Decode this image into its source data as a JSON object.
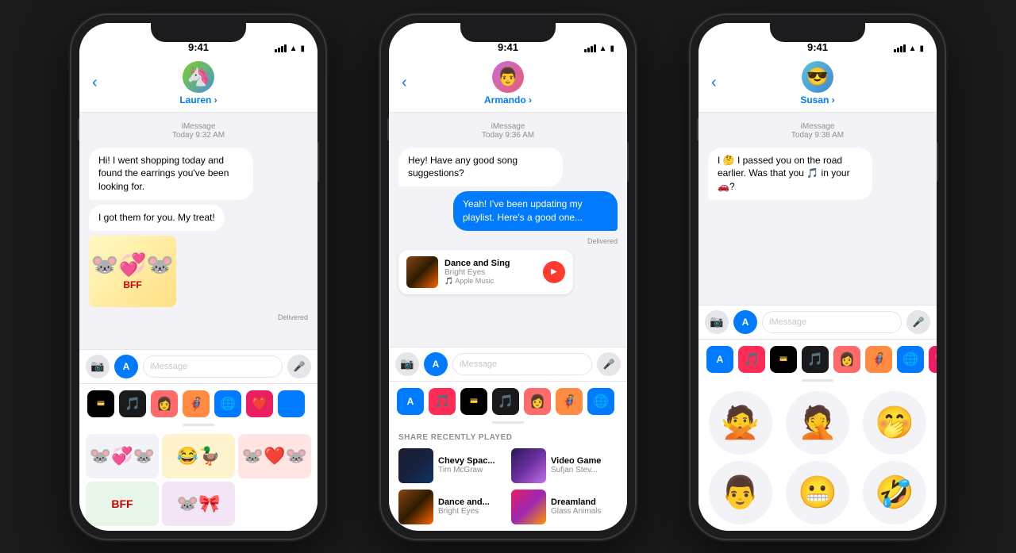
{
  "background": "#1a1a1a",
  "phones": [
    {
      "id": "phone1",
      "contact": {
        "name": "Lauren",
        "emoji": "🦄",
        "avatarBg": "linear-gradient(135deg, #7ed321, #4a90d9)"
      },
      "statusTime": "9:41",
      "messages": [
        {
          "type": "timestamp",
          "text": "iMessage\nToday 9:32 AM"
        },
        {
          "type": "received",
          "text": "Hi! I went shopping today and found the earrings you've been looking for."
        },
        {
          "type": "received",
          "text": "I got them for you. My treat!"
        },
        {
          "type": "sticker",
          "emoji": "🐭💕🐭"
        }
      ],
      "deliveredLabel": "Delivered",
      "inputPlaceholder": "iMessage",
      "trayIcons": [
        "💳",
        "🎵",
        "👩",
        "🦸",
        "🌐",
        "❤️",
        "🔵"
      ],
      "bottomStickers": [
        "mickey-minnie-1",
        "donald-duck",
        "mickey-minnie-2",
        "bff",
        "mickey-minnie-3"
      ]
    },
    {
      "id": "phone2",
      "contact": {
        "name": "Armando",
        "emoji": "👨",
        "avatarBg": "linear-gradient(135deg, #c86dd7, #e85d75)"
      },
      "statusTime": "9:41",
      "messages": [
        {
          "type": "timestamp",
          "text": "iMessage\nToday 9:36 AM"
        },
        {
          "type": "received",
          "text": "Hey! Have any good song suggestions?"
        },
        {
          "type": "sent",
          "text": "Yeah! I've been updating my playlist. Here's a good one..."
        },
        {
          "type": "music",
          "title": "Dance and Sing",
          "artist": "Bright Eyes",
          "source": "Apple Music"
        }
      ],
      "deliveredLabel": "Delivered",
      "inputPlaceholder": "iMessage",
      "trayIcons": [
        "📱",
        "🎵",
        "💳",
        "🎵",
        "👩",
        "🦸",
        "🌐"
      ],
      "shareSection": {
        "title": "SHARE RECENTLY PLAYED",
        "items": [
          {
            "title": "Chevy Spac...",
            "artist": "Tim McGraw",
            "thumbClass": "thumb-chevy"
          },
          {
            "title": "Video Game",
            "artist": "Sufjan Stev...",
            "thumbClass": "thumb-videogame"
          },
          {
            "title": "Dance and...",
            "artist": "Bright Eyes",
            "thumbClass": "thumb-dance"
          },
          {
            "title": "Dreamland",
            "artist": "Glass Animals",
            "thumbClass": "thumb-dreamland"
          }
        ]
      }
    },
    {
      "id": "phone3",
      "contact": {
        "name": "Susan",
        "emoji": "😎",
        "avatarBg": "linear-gradient(135deg, #5bc0de, #428bca)"
      },
      "statusTime": "9:41",
      "messages": [
        {
          "type": "timestamp",
          "text": "iMessage\nToday 9:38 AM"
        },
        {
          "type": "received",
          "text": "I 🤔 I passed you on the road earlier. Was that you 🎵 in your 🚗?"
        }
      ],
      "inputPlaceholder": "iMessage",
      "trayIcons": [
        "📱",
        "🎵",
        "💳",
        "🎵",
        "👩",
        "🦸",
        "🌐",
        "❤️"
      ],
      "memojiItems": [
        "🙅‍♂️",
        "🤦‍♂️",
        "🤭",
        "👨",
        "😬",
        "🤣"
      ]
    }
  ],
  "musicCard": {
    "title": "Dance and Sing",
    "artist": "Bright Eyes",
    "source": "Apple Music",
    "playIcon": "▶"
  },
  "shareSection": {
    "title": "SHARE RECENTLY PLAYED",
    "items": [
      {
        "title": "Chevy Spac...",
        "artist": "Tim McGraw"
      },
      {
        "title": "Video Game",
        "artist": "Sufjan Stev..."
      },
      {
        "title": "Dance and...",
        "artist": "Bright Eyes"
      },
      {
        "title": "Dreamland",
        "artist": "Glass Animals"
      }
    ]
  }
}
